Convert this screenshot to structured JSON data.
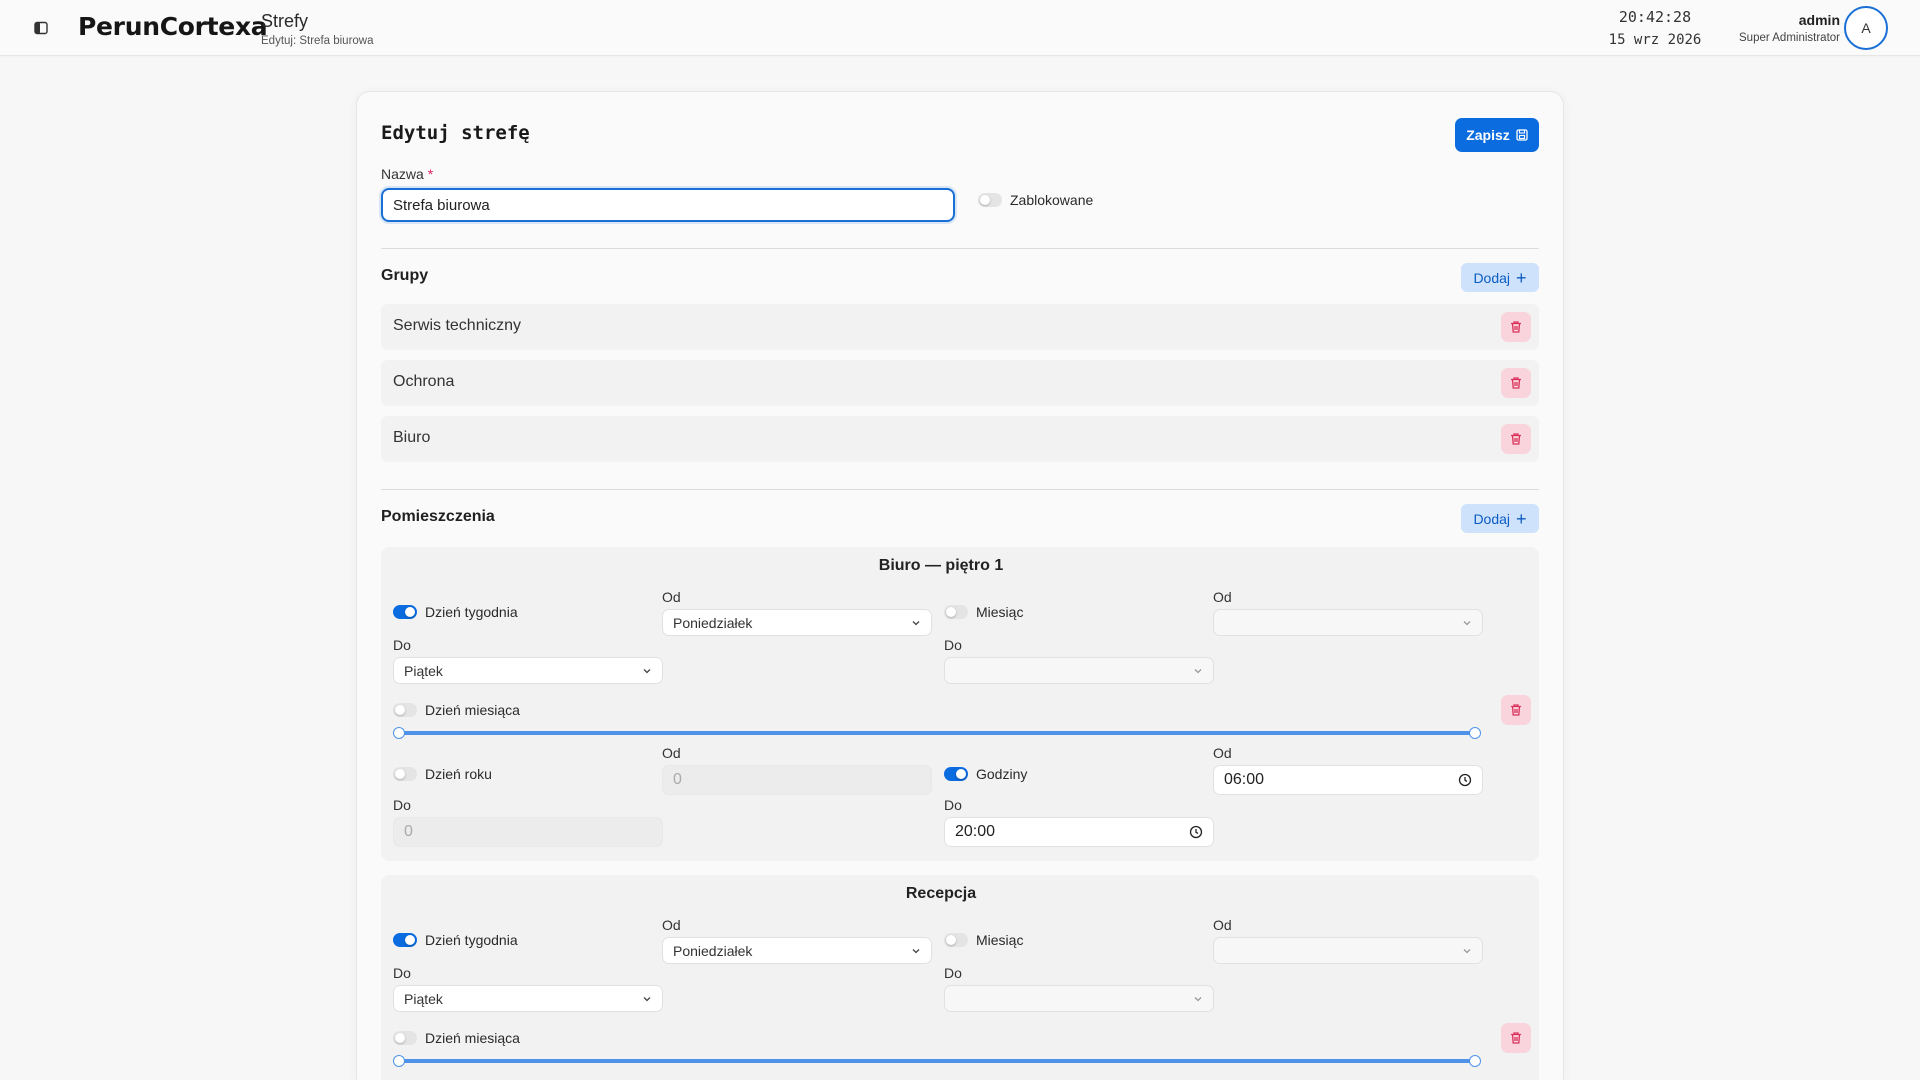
{
  "header": {
    "brand": "PerunCortexa",
    "title": "Strefy",
    "subtitle": "Edytuj: Strefa biurowa",
    "time": "20:42:28",
    "date": "15 wrz 2026",
    "user_name": "admin",
    "user_role": "Super Administrator",
    "avatar_initial": "A"
  },
  "form": {
    "title": "Edytuj strefę",
    "save_label": "Zapisz",
    "name_label": "Nazwa",
    "required_mark": "*",
    "name_value": "Strefa biurowa",
    "blocked_label": "Zablokowane",
    "blocked": false
  },
  "groups": {
    "title": "Grupy",
    "add_label": "Dodaj",
    "items": [
      "Serwis techniczny",
      "Ochrona",
      "Biuro"
    ]
  },
  "rooms": {
    "title": "Pomieszczenia",
    "add_label": "Dodaj",
    "labels": {
      "weekday": "Dzień tygodnia",
      "month": "Miesiąc",
      "day_of_month": "Dzień miesiąca",
      "day_of_year": "Dzień roku",
      "hours": "Godziny",
      "from": "Od",
      "to": "Do"
    },
    "items": [
      {
        "name": "Biuro — piętro 1",
        "weekday_enabled": true,
        "weekday_from": "Poniedziałek",
        "weekday_to": "Piątek",
        "month_enabled": false,
        "month_from": "",
        "month_to": "",
        "day_of_month_enabled": false,
        "day_of_month_range": [
          1,
          31
        ],
        "day_of_year_enabled": false,
        "day_of_year_from": "0",
        "day_of_year_to": "0",
        "hours_enabled": true,
        "hours_from": "06:00",
        "hours_to": "20:00"
      },
      {
        "name": "Recepcja",
        "weekday_enabled": true,
        "weekday_from": "Poniedziałek",
        "weekday_to": "Piątek",
        "month_enabled": false,
        "month_from": "",
        "month_to": "",
        "day_of_month_enabled": false,
        "day_of_month_range": [
          1,
          31
        ]
      }
    ]
  },
  "colors": {
    "primary": "#0b6ce0",
    "danger_bg": "#f9d4dc",
    "danger_icon": "#d9305a",
    "add_bg": "#cfe2fb"
  }
}
